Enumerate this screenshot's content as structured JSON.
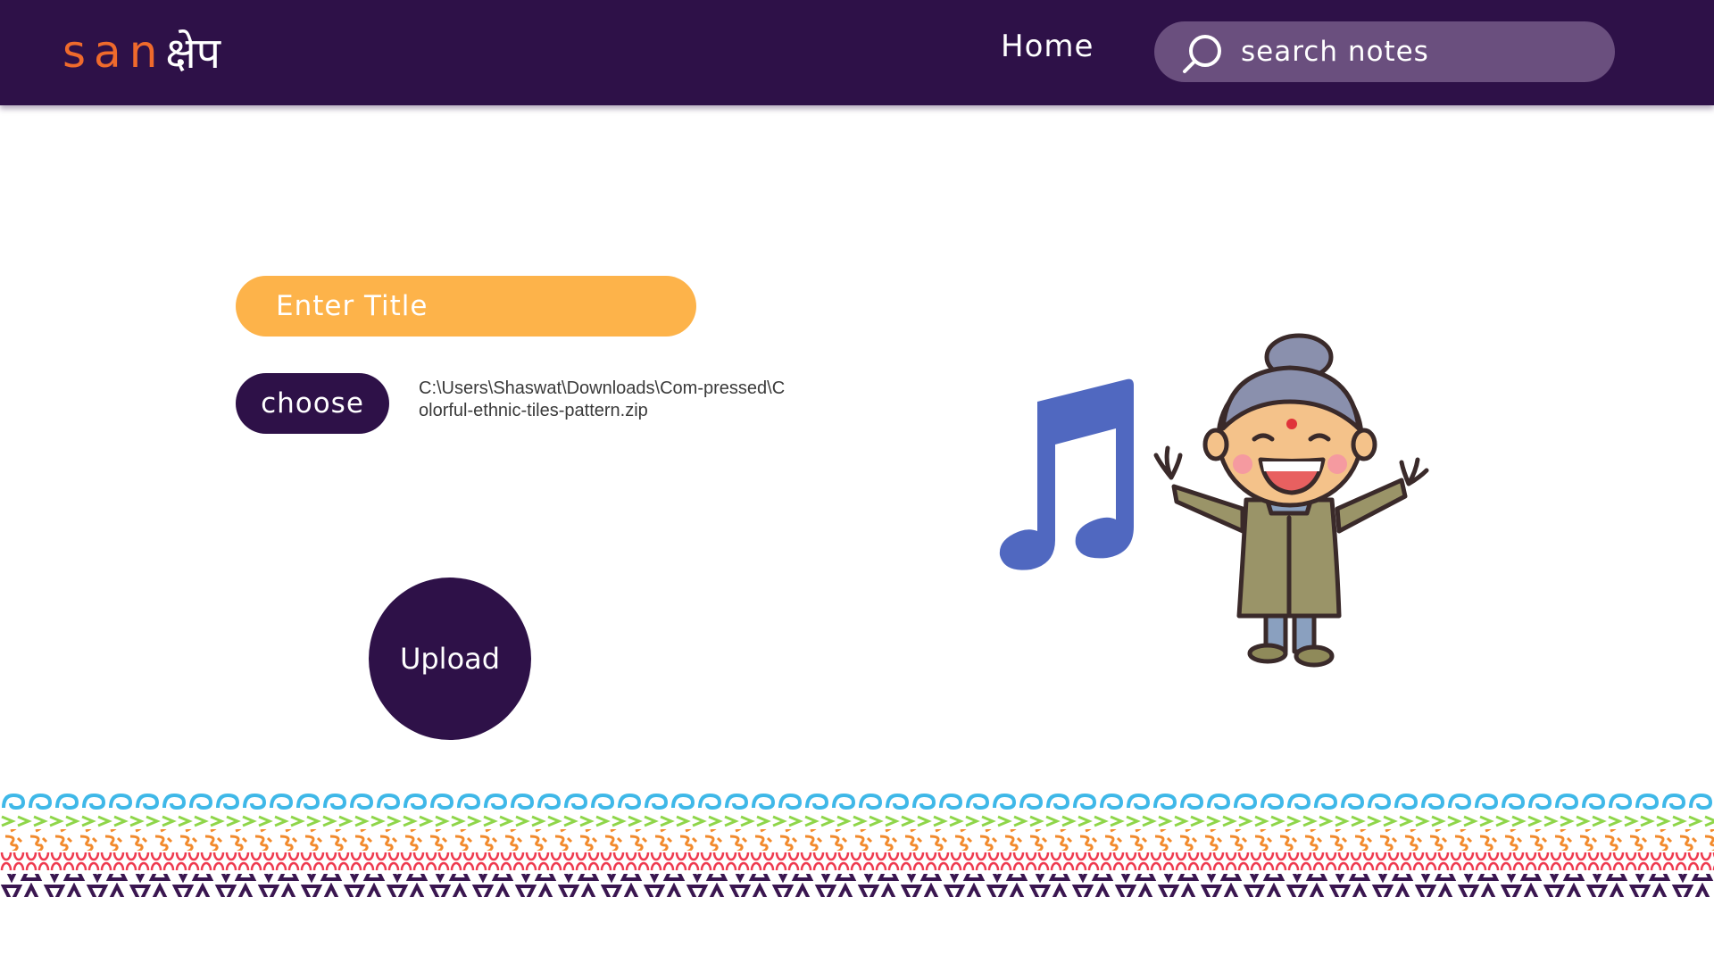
{
  "app": {
    "logo_latin": "san",
    "logo_devanagari": "क्षेप"
  },
  "header": {
    "nav_home": "Home",
    "search": {
      "placeholder": "search notes",
      "icon": "search-icon"
    }
  },
  "form": {
    "title_placeholder": "Enter Title",
    "choose_label": "choose",
    "file_path": "C:\\Users\\Shaswat\\Downloads\\Com-pressed\\Colorful-ethnic-tiles-pattern.zip",
    "upload_label": "Upload"
  },
  "illustration": {
    "icons": [
      "music-note-icon",
      "grandmother-character"
    ]
  },
  "colors": {
    "header_bg": "#2e1148",
    "logo_accent": "#ef6a2c",
    "search_bg": "#6a4f7e",
    "title_input_bg": "#fdb34a",
    "button_bg": "#2e1148",
    "music_note": "#5068c0"
  }
}
